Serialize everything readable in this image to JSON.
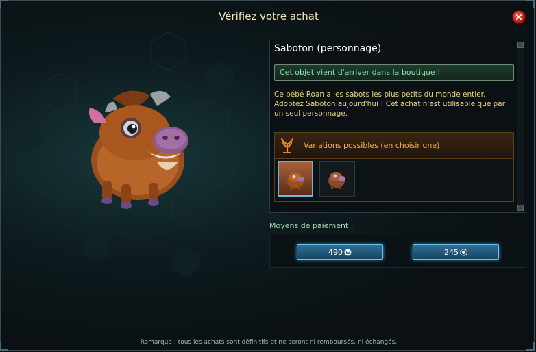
{
  "window": {
    "title": "Vérifiez votre achat"
  },
  "item": {
    "name": "Saboton (personnage)",
    "arrival_notice": "Cet objet vient d'arriver dans la boutique !",
    "description": "Ce bébé Roan a les sabots les plus petits du monde entier. Adoptez Saboton aujourd'hui ! Cet achat n'est utilisable que par un seul personnage."
  },
  "variations": {
    "label": "Variations possibles (en choisir une)",
    "options": [
      "variation-1",
      "variation-2"
    ],
    "selected_index": 0
  },
  "payment": {
    "label": "Moyens de paiement :",
    "options": [
      {
        "price": "490",
        "currency_icon": "premium-currency-icon"
      },
      {
        "price": "245",
        "currency_icon": "gem-currency-icon"
      }
    ]
  },
  "footer": {
    "disclaimer": "Remarque : tous les achats sont définitifs et ne seront ni remboursés, ni échangés."
  },
  "colors": {
    "title": "#f3e6b0",
    "arrival_text": "#7ee8a0",
    "description_text": "#e8d37a",
    "variation_label": "#f3b04a",
    "pay_button": "#2f6d97"
  }
}
